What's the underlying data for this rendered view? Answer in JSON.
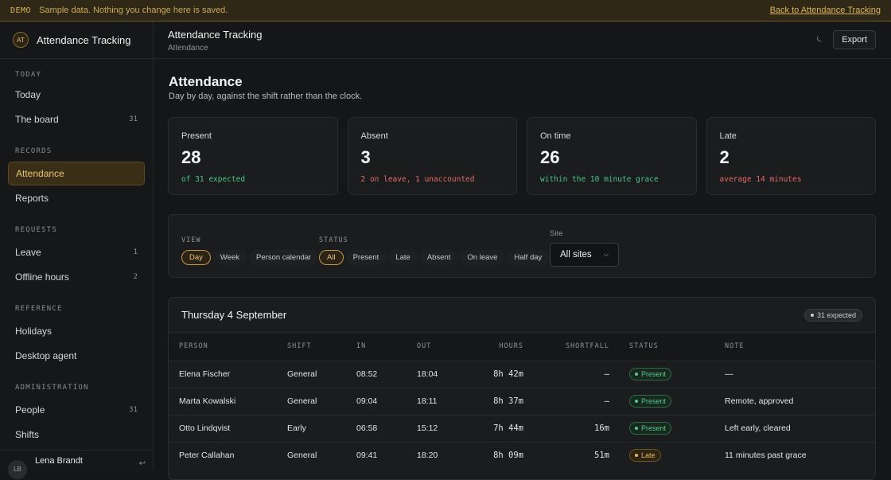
{
  "banner": {
    "tag": "DEMO",
    "message": "Sample data. Nothing you change here is saved.",
    "back_link": "Back to Attendance Tracking"
  },
  "sidebar": {
    "logo": "AT",
    "app_name": "Attendance Tracking",
    "sections": [
      {
        "heading": "TODAY",
        "items": [
          {
            "label": "Today",
            "count": ""
          },
          {
            "label": "The board",
            "count": "31"
          }
        ]
      },
      {
        "heading": "RECORDS",
        "items": [
          {
            "label": "Attendance",
            "count": "",
            "active": true
          },
          {
            "label": "Reports",
            "count": ""
          }
        ]
      },
      {
        "heading": "REQUESTS",
        "items": [
          {
            "label": "Leave",
            "count": "1"
          },
          {
            "label": "Offline hours",
            "count": "2"
          }
        ]
      },
      {
        "heading": "REFERENCE",
        "items": [
          {
            "label": "Holidays",
            "count": ""
          },
          {
            "label": "Desktop agent",
            "count": ""
          }
        ]
      },
      {
        "heading": "ADMINISTRATION",
        "items": [
          {
            "label": "People",
            "count": "31"
          },
          {
            "label": "Shifts",
            "count": ""
          }
        ]
      }
    ],
    "user": {
      "initials": "LB",
      "name": "Lena Brandt",
      "icon": "logout-icon"
    }
  },
  "header": {
    "title": "Attendance Tracking",
    "breadcrumb": "Attendance",
    "theme_icon": "moon-icon",
    "export_label": "Export"
  },
  "page": {
    "title": "Attendance",
    "subtitle": "Day by day, against the shift rather than the clock."
  },
  "stats": [
    {
      "label": "Present",
      "value": "28",
      "note": "of 31 expected",
      "tone": "green"
    },
    {
      "label": "Absent",
      "value": "3",
      "note": "2 on leave, 1 unaccounted",
      "tone": "red"
    },
    {
      "label": "On time",
      "value": "26",
      "note": "within the 10 minute grace",
      "tone": "green"
    },
    {
      "label": "Late",
      "value": "2",
      "note": "average 14 minutes",
      "tone": "red"
    }
  ],
  "filters": {
    "view_label": "VIEW",
    "view_options": [
      "Day",
      "Week",
      "Person calendar"
    ],
    "view_selected": "Day",
    "status_label": "STATUS",
    "status_options": [
      "All",
      "Present",
      "Late",
      "Absent",
      "On leave",
      "Half day"
    ],
    "status_selected": "All",
    "site_label": "Site",
    "site_value": "All sites"
  },
  "day": {
    "title": "Thursday 4 September",
    "badge": "31 expected",
    "columns": [
      "PERSON",
      "SHIFT",
      "IN",
      "OUT",
      "HOURS",
      "SHORTFALL",
      "STATUS",
      "NOTE"
    ],
    "rows": [
      {
        "person": "Elena Fischer",
        "shift": "General",
        "in": "08:52",
        "out": "18:04",
        "hours": "8h 42m",
        "shortfall": "–",
        "status": "Present",
        "status_kind": "present",
        "note": "—"
      },
      {
        "person": "Marta Kowalski",
        "shift": "General",
        "in": "09:04",
        "out": "18:11",
        "hours": "8h 37m",
        "shortfall": "–",
        "status": "Present",
        "status_kind": "present",
        "note": "Remote, approved"
      },
      {
        "person": "Otto Lindqvist",
        "shift": "Early",
        "in": "06:58",
        "out": "15:12",
        "hours": "7h 44m",
        "shortfall": "16m",
        "status": "Present",
        "status_kind": "present",
        "note": "Left early, cleared"
      },
      {
        "person": "Peter Callahan",
        "shift": "General",
        "in": "09:41",
        "out": "18:20",
        "hours": "8h 09m",
        "shortfall": "51m",
        "status": "Late",
        "status_kind": "late",
        "note": "11 minutes past grace"
      }
    ]
  }
}
